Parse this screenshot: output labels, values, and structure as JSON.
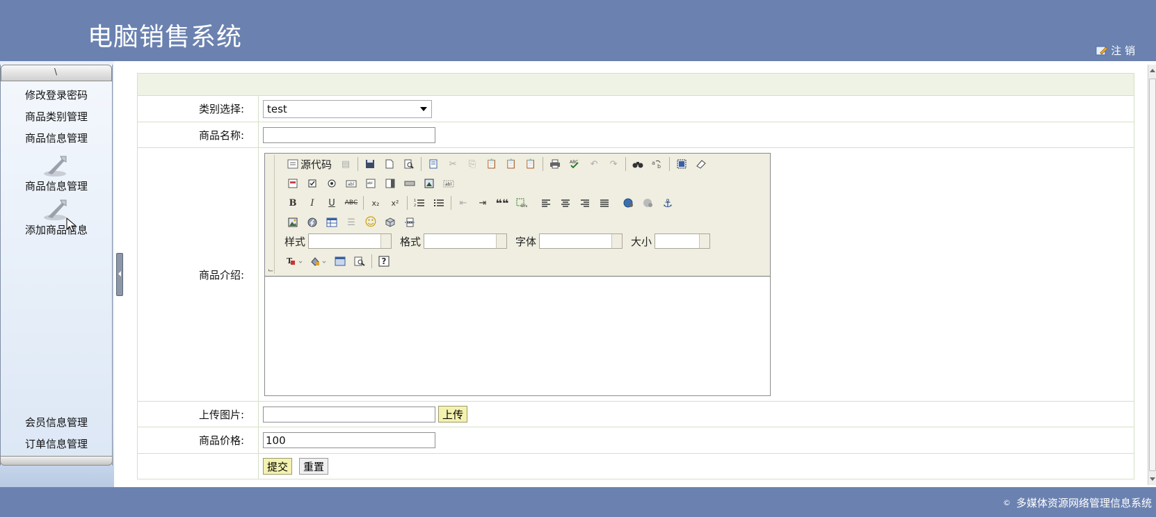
{
  "header": {
    "title": "电脑销售系统",
    "logout_label": "注 销"
  },
  "sidebar": {
    "collapse_glyph": "\\",
    "items": [
      {
        "label": "修改登录密码"
      },
      {
        "label": "商品类别管理"
      },
      {
        "label": "商品信息管理"
      }
    ],
    "sub_items": [
      {
        "label": "商品信息管理"
      },
      {
        "label": "添加商品信息"
      }
    ],
    "bottom_items": [
      {
        "label": "会员信息管理"
      },
      {
        "label": "订单信息管理"
      }
    ]
  },
  "form": {
    "category": {
      "label": "类别选择:",
      "value": "test"
    },
    "name": {
      "label": "商品名称:",
      "value": ""
    },
    "description": {
      "label": "商品介绍:",
      "toolbar": {
        "source_label": "源代码",
        "style_label": "样式",
        "format_label": "格式",
        "font_label": "字体",
        "size_label": "大小",
        "bold": "B",
        "italic": "I",
        "underline": "U",
        "strike": "ABC",
        "subscript": "x₂",
        "superscript": "x²",
        "blockquote": "❝❝",
        "help": "?"
      }
    },
    "image": {
      "label": "上传图片:",
      "value": "",
      "upload_label": "上传"
    },
    "price": {
      "label": "商品价格:",
      "value": "100"
    },
    "submit_label": "提交",
    "reset_label": "重置"
  },
  "footer": {
    "copyright_symbol": "©",
    "text": "多媒体资源网络管理信息系统"
  },
  "colors": {
    "header_bg": "#6b82b0",
    "form_border": "#d6dfc6",
    "band_bg": "#eef3e6",
    "button_yellow": "#f4f2b0"
  }
}
